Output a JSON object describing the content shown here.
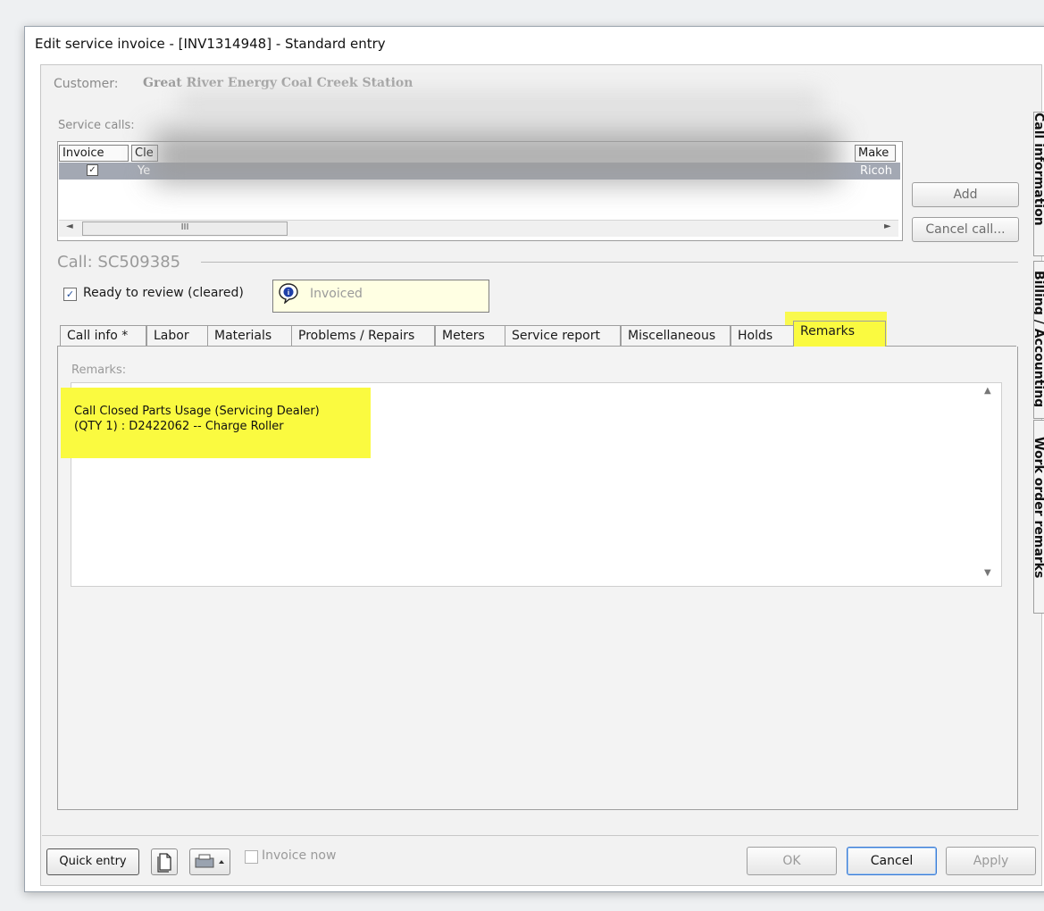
{
  "window": {
    "title": "Edit service invoice - [INV1314948] - Standard entry"
  },
  "customer": {
    "label": "Customer:",
    "value": "Great River Energy Coal Creek Station"
  },
  "service_calls": {
    "label": "Service calls:",
    "columns": [
      "Invoice",
      "Cle",
      "Make"
    ],
    "rows": [
      {
        "invoice_checked": true,
        "cleared": "Ye",
        "make": "Ricoh"
      }
    ],
    "scroll_thumb": "III"
  },
  "side_buttons": {
    "add": "Add",
    "cancel_call": "Cancel call..."
  },
  "call": {
    "title": "Call: SC509385",
    "ready_label": "Ready to review (cleared)",
    "ready_checked": true,
    "status": "Invoiced"
  },
  "tabs": [
    {
      "label": "Call info *"
    },
    {
      "label": "Labor"
    },
    {
      "label": "Materials"
    },
    {
      "label": "Problems / Repairs"
    },
    {
      "label": "Meters"
    },
    {
      "label": "Service report"
    },
    {
      "label": "Miscellaneous"
    },
    {
      "label": "Holds"
    },
    {
      "label": "Remarks",
      "active": true
    }
  ],
  "remarks": {
    "label": "Remarks:",
    "text": "Call Closed Parts Usage (Servicing Dealer)\n(QTY 1) : D2422062 -- Charge Roller"
  },
  "side_tabs": [
    "Call information",
    "Billing / Accounting",
    "Work order remarks"
  ],
  "footer": {
    "quick_entry": "Quick entry",
    "invoice_now": "Invoice now",
    "ok": "OK",
    "cancel": "Cancel",
    "apply": "Apply"
  },
  "colors": {
    "highlight": "#fafa40",
    "selected_row": "#a3a8b3",
    "info_bg": "#ffffe3"
  }
}
